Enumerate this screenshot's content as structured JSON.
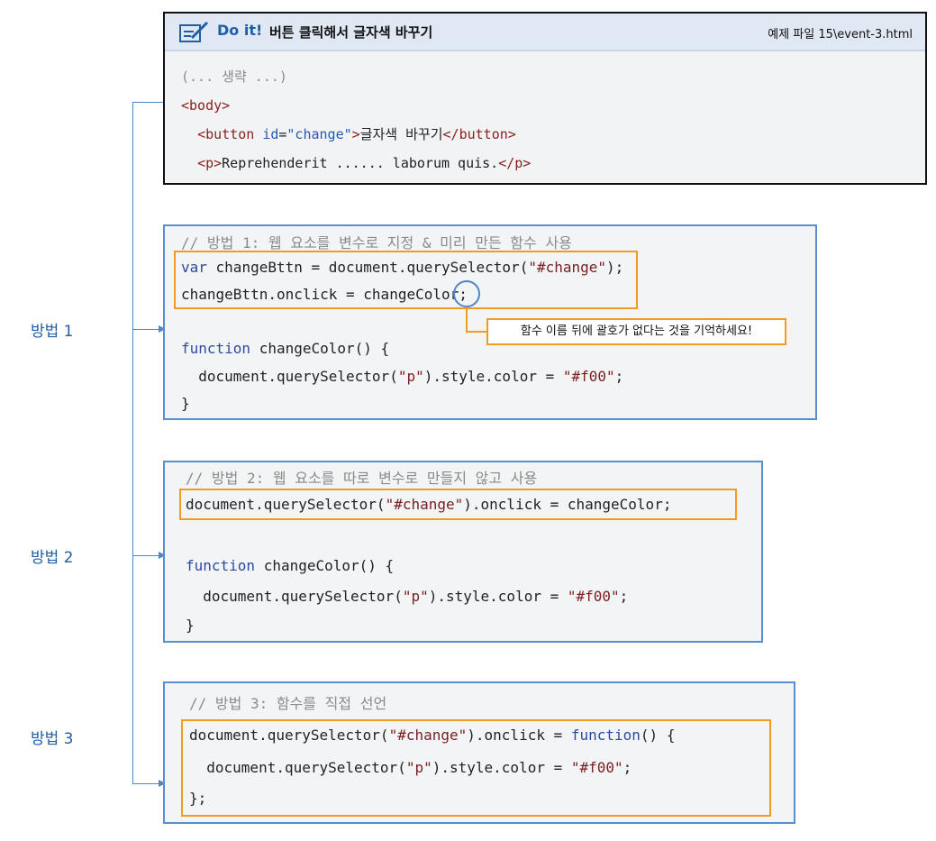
{
  "doit": {
    "tag": "Do it!",
    "title": "버튼 클릭해서 글자색 바꾸기",
    "file": "예제 파일 15\\event-3.html",
    "line_omitted": "(... 생략 ...)",
    "line_body": "<body>",
    "line_button_open": "<button",
    "line_button_attr": "id",
    "line_button_val": "\"change\"",
    "line_button_text": "글자색 바꾸기",
    "line_button_close": "</button>",
    "line_p_open": "<p>",
    "line_p_text": "Reprehenderit ...... laborum quis.",
    "line_p_close": "</p>"
  },
  "method1": {
    "side_label": "방법 1",
    "comment": "// 방법 1: 웹 요소를 변수로 지정 & 미리 만든 함수 사용",
    "l1_kw": "var",
    "l1_a": " changeBttn = document.querySelector(",
    "l1_str": "\"#change\"",
    "l1_b": ");",
    "l2": "changeBttn.onclick = changeColor;",
    "fn_kw": "function",
    "fn_sig": " changeColor() {",
    "body_a": "  document.querySelector(",
    "body_str1": "\"p\"",
    "body_b": ").style.color = ",
    "body_str2": "\"#f00\"",
    "body_c": ";",
    "close": "}",
    "callout": "함수 이름 뒤에 괄호가 없다는 것을 기억하세요!"
  },
  "method2": {
    "side_label": "방법 2",
    "comment": "// 방법 2: 웹 요소를 따로 변수로 만들지 않고 사용",
    "l1_a": "document.querySelector(",
    "l1_str": "\"#change\"",
    "l1_b": ").onclick = changeColor;",
    "fn_kw": "function",
    "fn_sig": " changeColor() {",
    "body_a": "  document.querySelector(",
    "body_str1": "\"p\"",
    "body_b": ").style.color = ",
    "body_str2": "\"#f00\"",
    "body_c": ";",
    "close": "}"
  },
  "method3": {
    "side_label": "방법 3",
    "comment": "// 방법 3: 함수를 직접 선언",
    "l1_a": "document.querySelector(",
    "l1_str": "\"#change\"",
    "l1_b": ").onclick = ",
    "l1_kw": "function",
    "l1_c": "() {",
    "body_a": "  document.querySelector(",
    "body_str1": "\"p\"",
    "body_b": ").style.color = ",
    "body_str2": "\"#f00\"",
    "body_c": ";",
    "close": "};"
  },
  "colors": {
    "highlight": "#f39a21",
    "connector": "#4f86c6",
    "keyword": "#2d4aa0",
    "string": "#7a2020",
    "label": "#1f5fa8"
  }
}
